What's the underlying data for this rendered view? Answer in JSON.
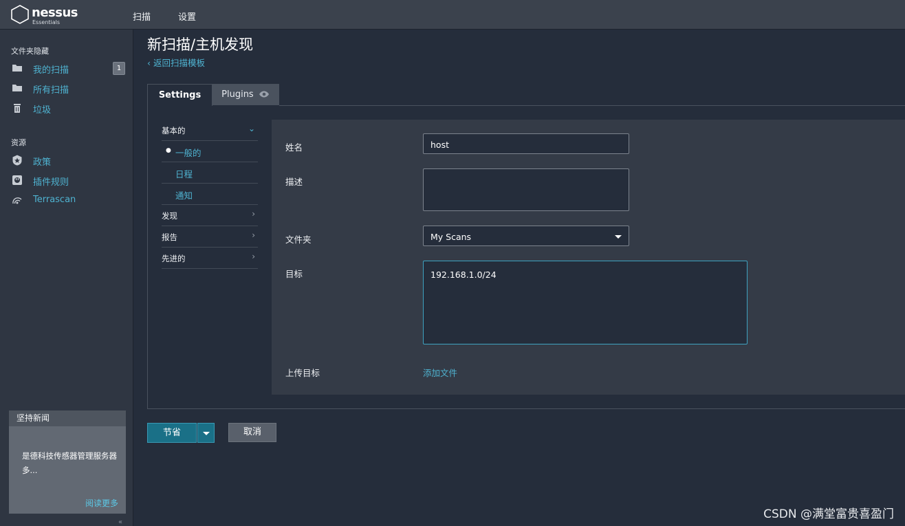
{
  "app": {
    "logo_name": "nessus",
    "logo_sub": "Essentials"
  },
  "topnav": {
    "scans": "扫描",
    "settings": "设置"
  },
  "sidebar": {
    "folders_title": "文件夹隐藏",
    "folders": [
      {
        "label": "我的扫描",
        "icon": "folder-icon",
        "badge": "1"
      },
      {
        "label": "所有扫描",
        "icon": "folder-icon"
      },
      {
        "label": "垃圾",
        "icon": "trash-icon"
      }
    ],
    "resources_title": "资源",
    "resources": [
      {
        "label": "政策",
        "icon": "shield-icon"
      },
      {
        "label": "插件规则",
        "icon": "plugin-rules-icon"
      },
      {
        "label": "Terrascan",
        "icon": "terrascan-icon"
      }
    ]
  },
  "news": {
    "title": "坚持新闻",
    "body": "是德科技传感器管理服务器多...",
    "more": "阅读更多"
  },
  "main": {
    "title": "新扫描/主机发现",
    "back": "返回扫描模板",
    "tabs": {
      "settings": "Settings",
      "plugins": "Plugins"
    },
    "nav": {
      "basic": "基本的",
      "general": "一般的",
      "schedule": "日程",
      "notify": "通知",
      "discovery": "发现",
      "report": "报告",
      "advanced": "先进的"
    },
    "form": {
      "name_label": "姓名",
      "name_value": "host",
      "desc_label": "描述",
      "desc_value": "",
      "folder_label": "文件夹",
      "folder_value": "My Scans",
      "target_label": "目标",
      "target_value": "192.168.1.0/24",
      "upload_label": "上传目标",
      "add_file": "添加文件"
    },
    "buttons": {
      "save": "节省",
      "cancel": "取消"
    }
  },
  "watermark": "CSDN @满堂富贵喜盈门",
  "colors": {
    "accent": "#4fb3d1",
    "background": "#252d3b",
    "sidebar": "#2f3642",
    "save_button": "#1a7087"
  }
}
